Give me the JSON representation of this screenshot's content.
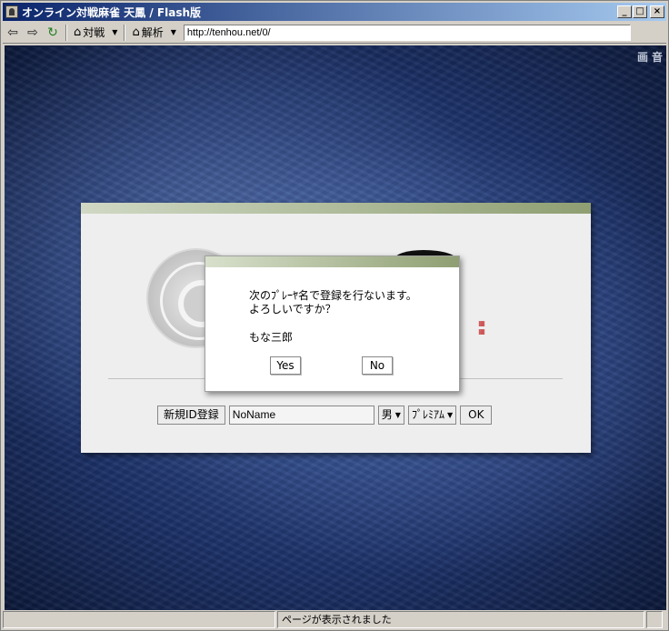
{
  "window": {
    "title": "オンライン対戦麻雀 天鳳 / Flash版",
    "minimize": "_",
    "maximize": "□",
    "close": "×"
  },
  "toolbar": {
    "back_icon": "⇦",
    "forward_icon": "⇨",
    "refresh_icon": "↻",
    "menu1_label": "対戦",
    "menu2_label": "解析",
    "address": "http://tenhou.net/0/"
  },
  "content": {
    "corner_labels": [
      "画",
      "音"
    ]
  },
  "login_panel": {
    "register_button": "新規ID登録",
    "name_value": "NoName",
    "gender_select": "男",
    "mode_select": "ﾌﾟﾚﾐｱﾑ",
    "ok_button": "OK"
  },
  "dialog": {
    "message_line1": "次のﾌﾟﾚｰﾔ名で登録を行ないます。",
    "message_line2": "よろしいですか？",
    "player_name": "もな三郎",
    "yes_button": "Yes",
    "no_button": "No"
  },
  "statusbar": {
    "message": "ページが表示されました"
  }
}
